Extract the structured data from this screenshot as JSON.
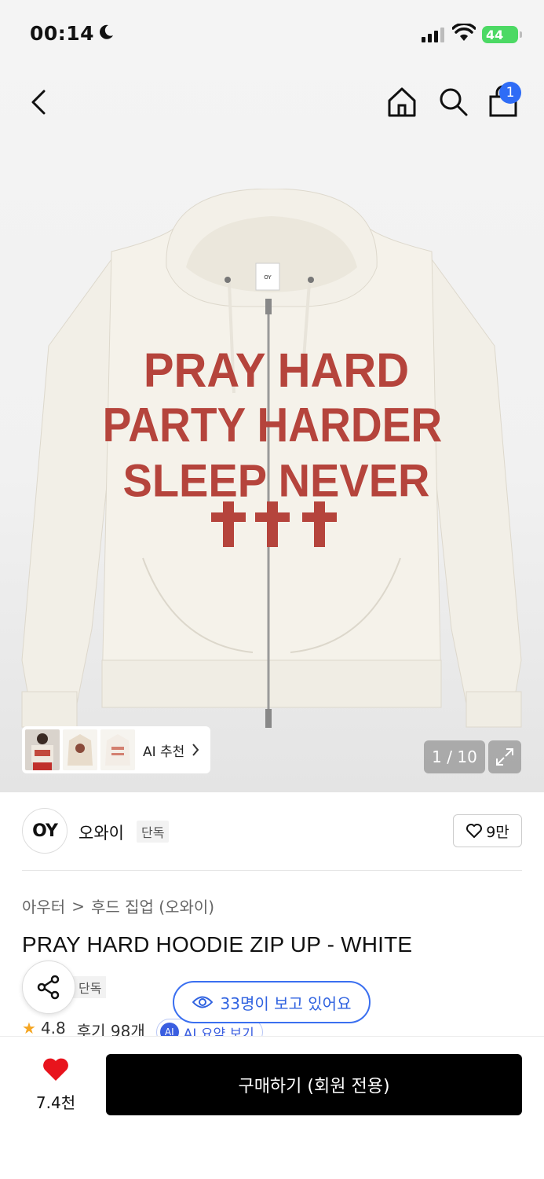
{
  "status": {
    "time": "00:14",
    "battery": "44"
  },
  "cart": {
    "badge": "1"
  },
  "hero": {
    "print_lines": [
      "PRAY HARD",
      "PARTY HARDER",
      "SLEEP NEVER"
    ],
    "tag_text": "OY",
    "ai_recommend_label": "AI 추천",
    "counter": "1 / 10"
  },
  "brand": {
    "logo_text": "OY",
    "name": "오와이",
    "tag": "단독",
    "likes": "9만"
  },
  "breadcrumb": {
    "level1": "아우터",
    "separator": ">",
    "level2": "후드 집업 (오와이)"
  },
  "product": {
    "title": "PRAY HARD HOODIE ZIP UP - WHITE",
    "exclusive_tag": "단독"
  },
  "viewers": {
    "text": "33명이 보고 있어요"
  },
  "rating": {
    "score": "4.8",
    "reviews": "후기 98개",
    "ai_badge": "AI",
    "ai_summary": "AI 요약 보기"
  },
  "bottom": {
    "wish_count": "7.4천",
    "buy_label": "구매하기 (회원 전용)"
  },
  "colors": {
    "accent_blue": "#2f6cf6",
    "heart_red": "#e8141d",
    "print_red": "#b5443c",
    "buy_black": "#000000"
  }
}
